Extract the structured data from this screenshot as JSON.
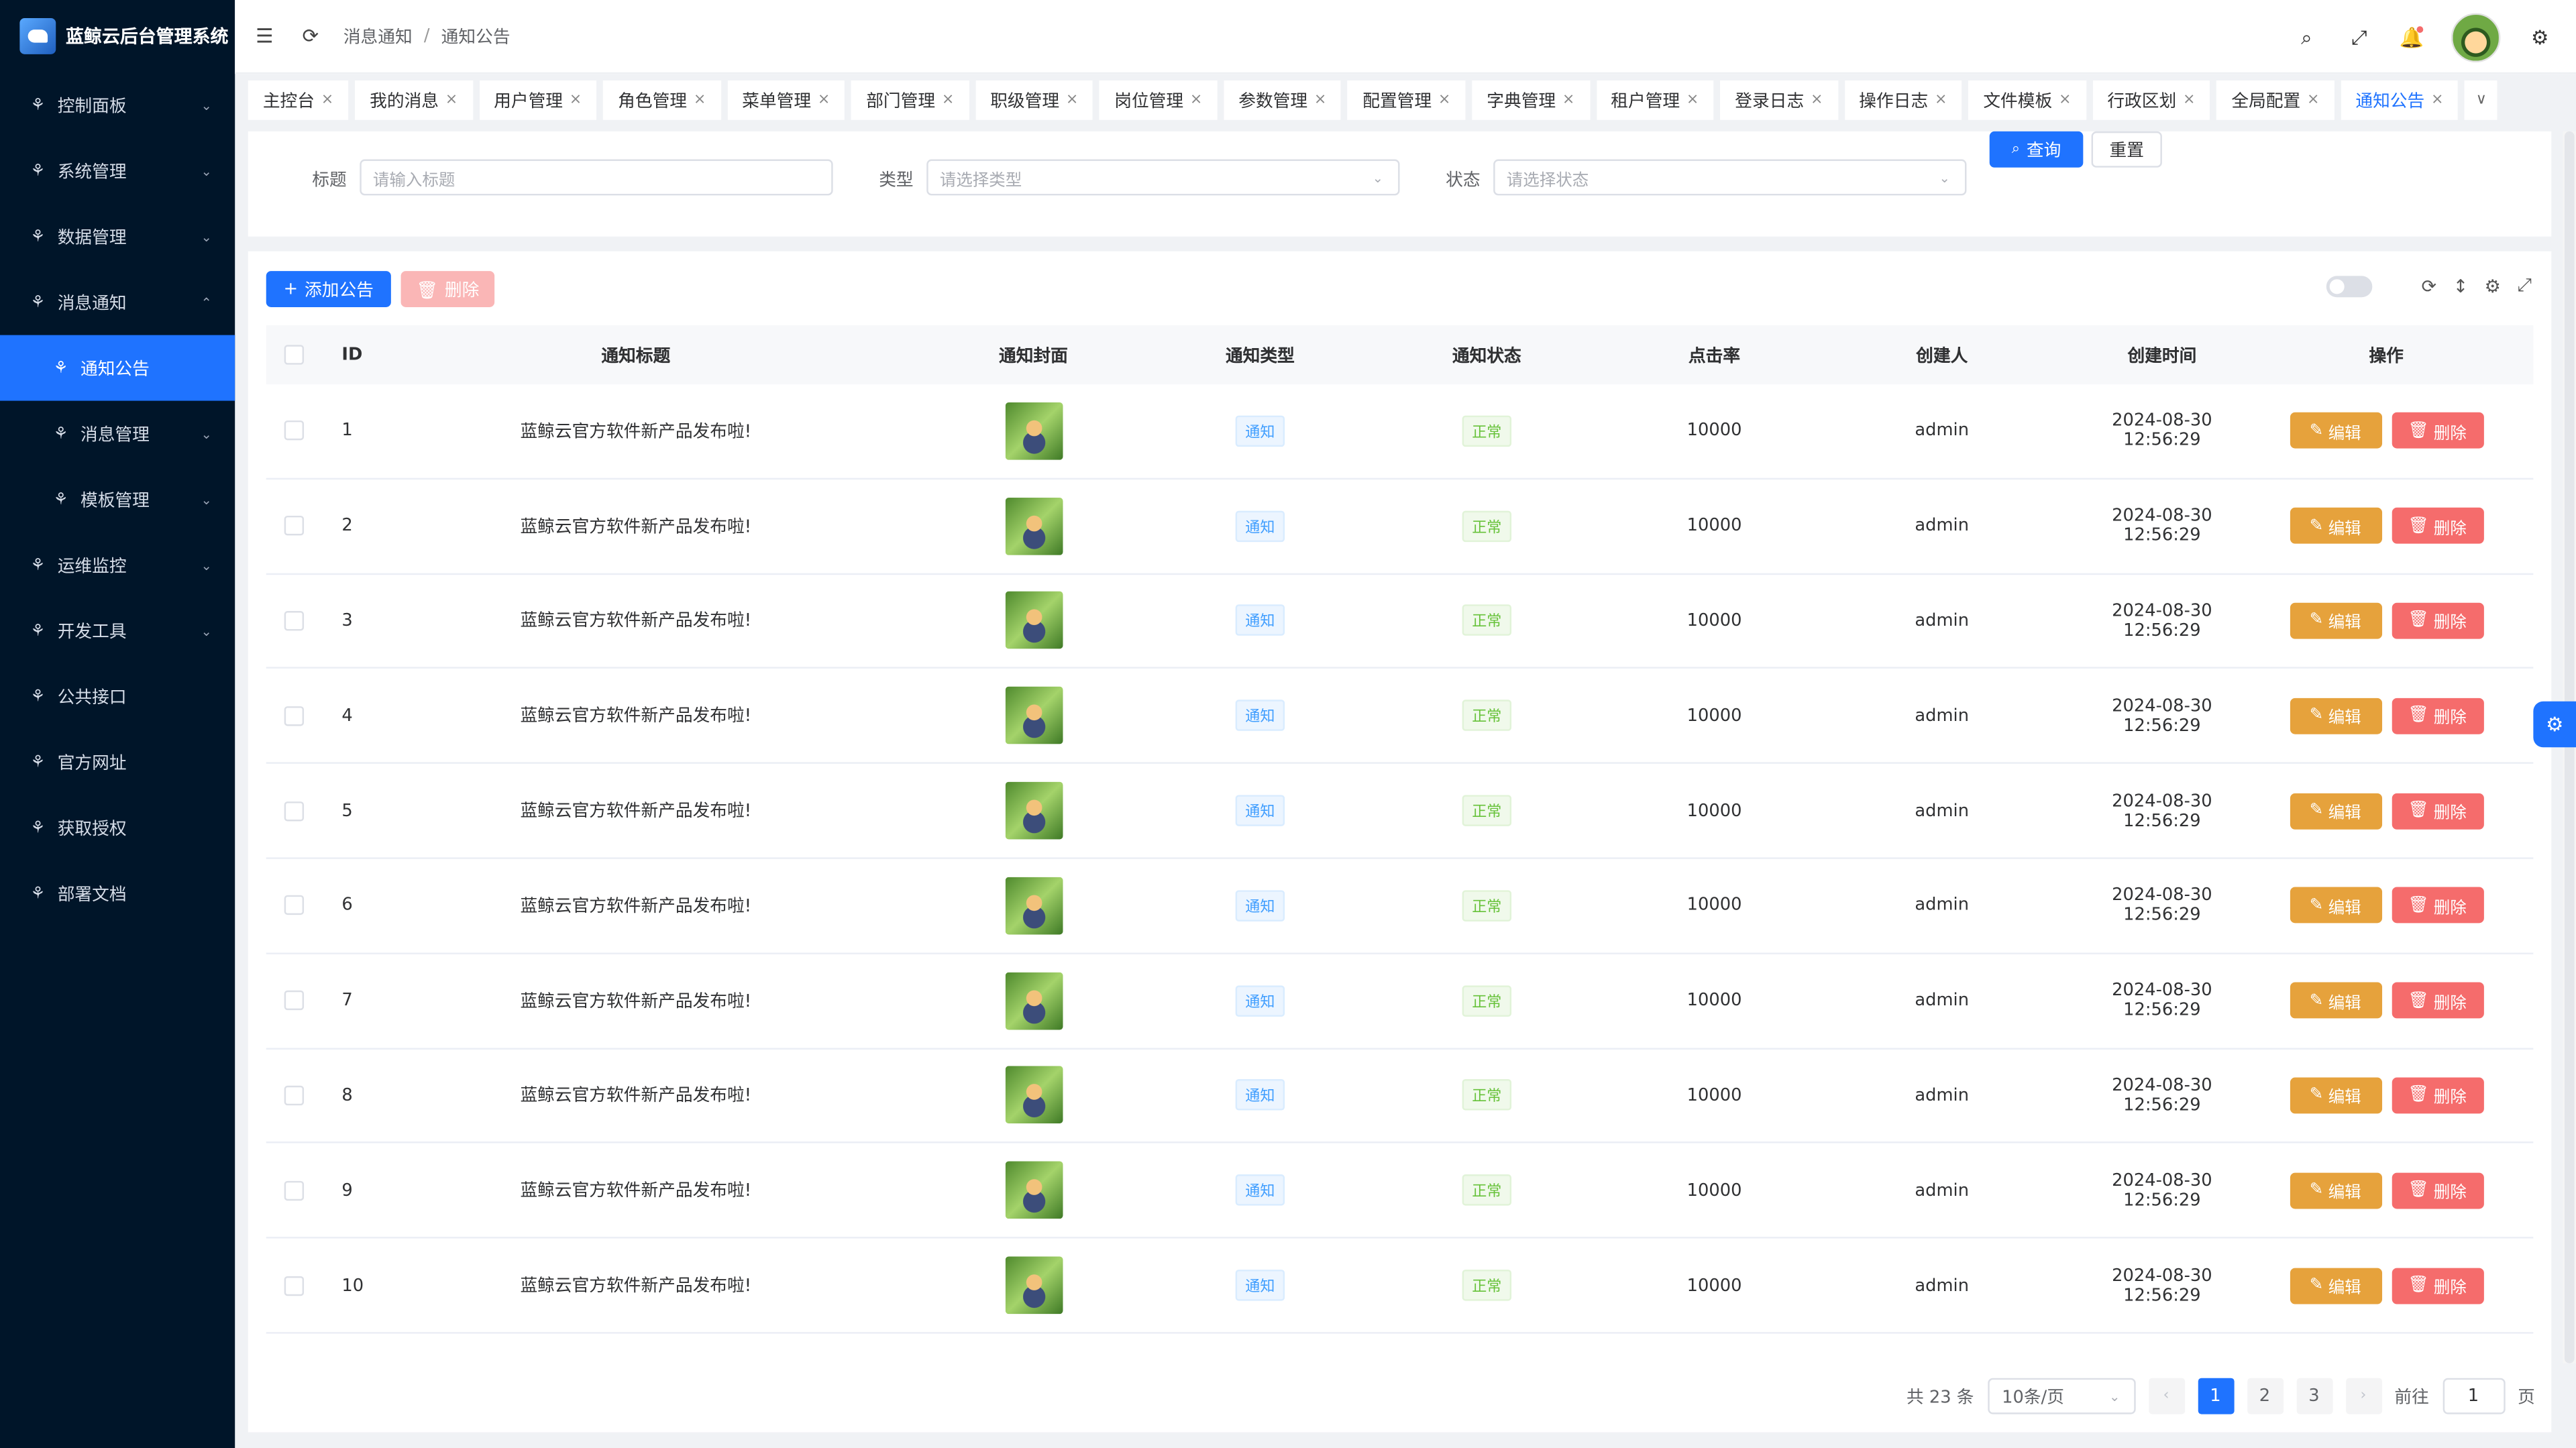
{
  "app": {
    "title": "蓝鲸云后台管理系统",
    "accent": "#1f73ff"
  },
  "sidebar": {
    "items": [
      {
        "label": "控制面板",
        "icon": "apps-icon",
        "caret": "⌄"
      },
      {
        "label": "系统管理",
        "icon": "apps-icon",
        "caret": "⌄"
      },
      {
        "label": "数据管理",
        "icon": "apps-icon",
        "caret": "⌄"
      },
      {
        "label": "消息通知",
        "icon": "apps-icon",
        "caret": "⌃"
      },
      {
        "label": "通知公告",
        "icon": "apps-icon",
        "active": true,
        "sub": true
      },
      {
        "label": "消息管理",
        "icon": "apps-icon",
        "sub": true,
        "caret": "⌄"
      },
      {
        "label": "模板管理",
        "icon": "apps-icon",
        "sub": true,
        "caret": "⌄"
      },
      {
        "label": "运维监控",
        "icon": "apps-icon",
        "caret": "⌄"
      },
      {
        "label": "开发工具",
        "icon": "apps-icon",
        "caret": "⌄"
      },
      {
        "label": "公共接口",
        "icon": "apps-icon"
      },
      {
        "label": "官方网址",
        "icon": "apps-icon"
      },
      {
        "label": "获取授权",
        "icon": "apps-icon"
      },
      {
        "label": "部署文档",
        "icon": "apps-icon"
      }
    ]
  },
  "header": {
    "breadcrumb": [
      "消息通知",
      "通知公告"
    ],
    "breadcrumb_sep": "/"
  },
  "tabs": [
    {
      "label": "主控台"
    },
    {
      "label": "我的消息"
    },
    {
      "label": "用户管理"
    },
    {
      "label": "角色管理"
    },
    {
      "label": "菜单管理"
    },
    {
      "label": "部门管理"
    },
    {
      "label": "职级管理"
    },
    {
      "label": "岗位管理"
    },
    {
      "label": "参数管理"
    },
    {
      "label": "配置管理"
    },
    {
      "label": "字典管理"
    },
    {
      "label": "租户管理"
    },
    {
      "label": "登录日志"
    },
    {
      "label": "操作日志"
    },
    {
      "label": "文件模板"
    },
    {
      "label": "行政区划"
    },
    {
      "label": "全局配置"
    },
    {
      "label": "通知公告",
      "active": true
    }
  ],
  "filter": {
    "title_label": "标题",
    "title_placeholder": "请输入标题",
    "type_label": "类型",
    "type_placeholder": "请选择类型",
    "status_label": "状态",
    "status_placeholder": "请选择状态",
    "search_label": "查询",
    "reset_label": "重置"
  },
  "toolbar": {
    "add_label": "添加公告",
    "delete_label": "删除"
  },
  "table": {
    "columns": [
      "ID",
      "通知标题",
      "通知封面",
      "通知类型",
      "通知状态",
      "点击率",
      "创建人",
      "创建时间",
      "操作"
    ],
    "rows": [
      {
        "id": "1",
        "title": "蓝鲸云官方软件新产品发布啦!",
        "type": "通知",
        "status": "正常",
        "clicks": "10000",
        "creator": "admin",
        "created": "2024-08-30 12:56:29"
      },
      {
        "id": "2",
        "title": "蓝鲸云官方软件新产品发布啦!",
        "type": "通知",
        "status": "正常",
        "clicks": "10000",
        "creator": "admin",
        "created": "2024-08-30 12:56:29"
      },
      {
        "id": "3",
        "title": "蓝鲸云官方软件新产品发布啦!",
        "type": "通知",
        "status": "正常",
        "clicks": "10000",
        "creator": "admin",
        "created": "2024-08-30 12:56:29"
      },
      {
        "id": "4",
        "title": "蓝鲸云官方软件新产品发布啦!",
        "type": "通知",
        "status": "正常",
        "clicks": "10000",
        "creator": "admin",
        "created": "2024-08-30 12:56:29"
      },
      {
        "id": "5",
        "title": "蓝鲸云官方软件新产品发布啦!",
        "type": "通知",
        "status": "正常",
        "clicks": "10000",
        "creator": "admin",
        "created": "2024-08-30 12:56:29"
      },
      {
        "id": "6",
        "title": "蓝鲸云官方软件新产品发布啦!",
        "type": "通知",
        "status": "正常",
        "clicks": "10000",
        "creator": "admin",
        "created": "2024-08-30 12:56:29"
      },
      {
        "id": "7",
        "title": "蓝鲸云官方软件新产品发布啦!",
        "type": "通知",
        "status": "正常",
        "clicks": "10000",
        "creator": "admin",
        "created": "2024-08-30 12:56:29"
      },
      {
        "id": "8",
        "title": "蓝鲸云官方软件新产品发布啦!",
        "type": "通知",
        "status": "正常",
        "clicks": "10000",
        "creator": "admin",
        "created": "2024-08-30 12:56:29"
      },
      {
        "id": "9",
        "title": "蓝鲸云官方软件新产品发布啦!",
        "type": "通知",
        "status": "正常",
        "clicks": "10000",
        "creator": "admin",
        "created": "2024-08-30 12:56:29"
      },
      {
        "id": "10",
        "title": "蓝鲸云官方软件新产品发布啦!",
        "type": "通知",
        "status": "正常",
        "clicks": "10000",
        "creator": "admin",
        "created": "2024-08-30 12:56:29"
      }
    ],
    "edit_label": "编辑",
    "delete_label": "删除"
  },
  "pagination": {
    "total_text": "共 23 条",
    "page_size": "10条/页",
    "pages": [
      "1",
      "2",
      "3"
    ],
    "current": "1",
    "goto_label": "前往",
    "goto_value": "1",
    "page_unit": "页"
  }
}
